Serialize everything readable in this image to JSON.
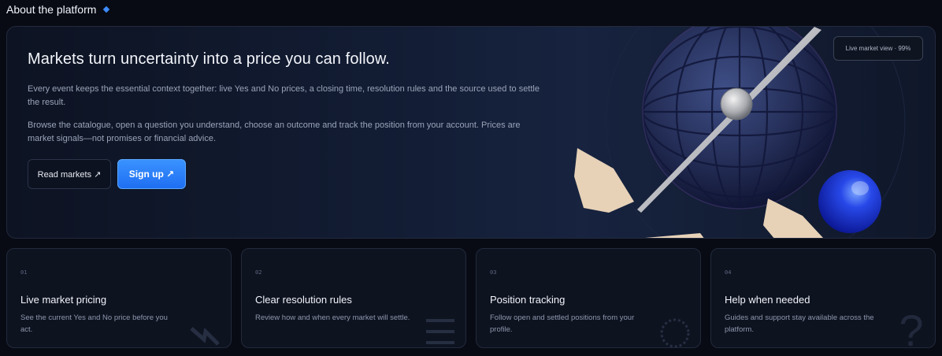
{
  "section": {
    "title": "About the platform"
  },
  "hero": {
    "title": "Markets turn uncertainty into a price you can follow.",
    "paragraph_1": "Every event keeps the essential context together: live Yes and No prices, a closing time, resolution rules and the source used to settle the result.",
    "paragraph_2": "Browse the catalogue, open a question you understand, choose an outcome and track the position from your account. Prices are market signals—not promises or financial advice.",
    "read_markets_label": "Read markets ↗",
    "sign_up_label": "Sign up ↗",
    "badge": "Live market view · 99%"
  },
  "features": [
    {
      "num": "01",
      "title": "Live market pricing",
      "desc": "See the current Yes and No price before you act.",
      "icon": "lightning-icon"
    },
    {
      "num": "02",
      "title": "Clear resolution rules",
      "desc": "Review how and when every market will settle.",
      "icon": "list-lines-icon"
    },
    {
      "num": "03",
      "title": "Position tracking",
      "desc": "Follow open and settled positions from your profile.",
      "icon": "dotted-circle-icon"
    },
    {
      "num": "04",
      "title": "Help when needed",
      "desc": "Guides and support stay available across the platform.",
      "icon": "question-mark-icon"
    }
  ],
  "colors": {
    "background": "#080b14",
    "accent": "#2f86ff",
    "card_bg": "#0e1320"
  }
}
